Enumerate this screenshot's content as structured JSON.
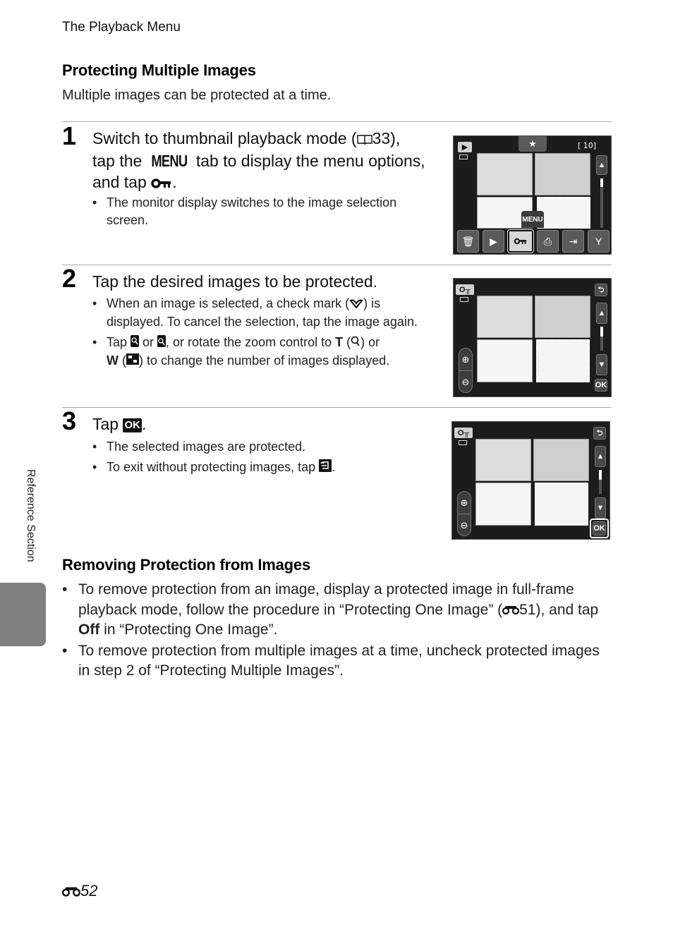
{
  "running_head": "The Playback Menu",
  "section1": {
    "title": "Protecting Multiple Images",
    "intro": "Multiple images can be protected at a time."
  },
  "steps": [
    {
      "number": "1",
      "title_parts": {
        "a": "Switch to thumbnail playback mode (",
        "ref_icon": "book-icon",
        "ref_page": "33",
        "b": "),",
        "c": "tap the ",
        "menu_word": "MENU",
        "d": " tab to display the menu options,",
        "e": "and tap ",
        "key_icon": "protect-key-icon",
        "f": "."
      },
      "bullets": [
        "The monitor display switches to the image selection screen."
      ],
      "screen": {
        "top_tab_icon": "star-icon",
        "counter": "[ 10]",
        "mode_icon": "playback-icon",
        "menu_tab_label": "MENU",
        "tools": [
          {
            "icon": "trash-icon",
            "glyph": "🗑",
            "selected": false
          },
          {
            "icon": "slideshow-icon",
            "glyph": "▶",
            "selected": false
          },
          {
            "icon": "protect-key-icon",
            "glyph": "O╥",
            "selected": true
          },
          {
            "icon": "print-order-icon",
            "glyph": "⎙",
            "selected": false
          },
          {
            "icon": "copy-icon",
            "glyph": "⇥",
            "selected": false
          },
          {
            "icon": "setup-wrench-icon",
            "glyph": "Y",
            "selected": false
          }
        ],
        "scroll_position": 0.1
      }
    },
    {
      "number": "2",
      "title": "Tap the desired images to be protected.",
      "bullets": [
        {
          "a": "When an image is selected, a check mark (",
          "icon": "check-mark-icon",
          "glyph": "✓",
          "b": ") is displayed. To cancel the selection, tap the image again."
        },
        {
          "a": "Tap ",
          "icon1": "zoom-in-icon",
          "mid1": " or ",
          "icon2": "zoom-out-icon",
          "mid2": ", or rotate the zoom control to ",
          "t": "T",
          "mid3": " (",
          "icon3": "magnify-icon",
          "mid4": ") or ",
          "w": "W",
          "mid5": " (",
          "icon4": "thumbnail-grid-icon",
          "b": ") to change the number of images displayed."
        }
      ],
      "screen": {
        "mode_badge": "O╥",
        "back_label": "⮌",
        "ok_label": "OK",
        "zoom_in": "⊕",
        "zoom_out": "⊖",
        "scroll_position": 0.4,
        "ok_highlighted": false
      }
    },
    {
      "number": "3",
      "title_a": "Tap ",
      "title_ok": "OK",
      "title_b": ".",
      "bullets": [
        {
          "text": "The selected images are protected."
        },
        {
          "a": "To exit without protecting images, tap ",
          "icon": "back-icon",
          "b": "."
        }
      ],
      "screen": {
        "mode_badge": "O╥",
        "back_label": "⮌",
        "ok_label": "OK",
        "zoom_in": "⊕",
        "zoom_out": "⊖",
        "scroll_position": 0.4,
        "ok_highlighted": true
      }
    }
  ],
  "section2": {
    "title": "Removing Protection from Images",
    "bullets": [
      {
        "a": "To remove protection from an image, display a protected image in full-frame playback mode, follow the procedure in “Protecting One Image” (",
        "ref_icon": "reference-section-icon",
        "ref_page": "51",
        "b": "), and tap ",
        "bold": "Off",
        "c": " in “Protecting One Image”."
      },
      {
        "text": "To remove protection from multiple images at a time, uncheck protected images in step 2 of “Protecting Multiple Images”."
      }
    ]
  },
  "side_label": "Reference Section",
  "folio": {
    "icon": "reference-section-icon",
    "page": "52"
  },
  "colors": {
    "side_tab": "#808080",
    "rule": "#a9a9a9",
    "screen_bg": "#1c1c1c"
  }
}
